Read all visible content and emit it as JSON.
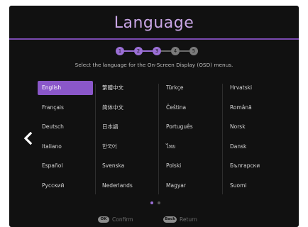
{
  "screen": {
    "title": "Language",
    "instruction": "Select the language for the On-Screen Display (OSD) menus."
  },
  "steps": {
    "labels": [
      "1",
      "2",
      "3",
      "4",
      "5"
    ],
    "active_count": 3
  },
  "languages": {
    "columns": [
      [
        "English",
        "Français",
        "Deutsch",
        "Italiano",
        "Español",
        "Русский"
      ],
      [
        "繁體中文",
        "简体中文",
        "日本語",
        "한국어",
        "Svenska",
        "Nederlands"
      ],
      [
        "Türkçe",
        "Čeština",
        "Português",
        "ไทย",
        "Polski",
        "Magyar"
      ],
      [
        "Hrvatski",
        "Română",
        "Norsk",
        "Dansk",
        "Български",
        "Suomi"
      ]
    ],
    "selected": "English"
  },
  "pagination": {
    "pages": 2,
    "current": 1
  },
  "footer": {
    "ok_key": "OK",
    "ok_label": "Confirm",
    "back_key": "Back",
    "back_label": "Return"
  },
  "icons": {
    "back": "chevron-left-icon"
  },
  "colors": {
    "background": "#111111",
    "accent": "#9b6fd6",
    "title": "#c9a6e6",
    "selected_bg": "#8a57c9",
    "text": "#d6d6d6",
    "muted": "#6e6e6e"
  }
}
